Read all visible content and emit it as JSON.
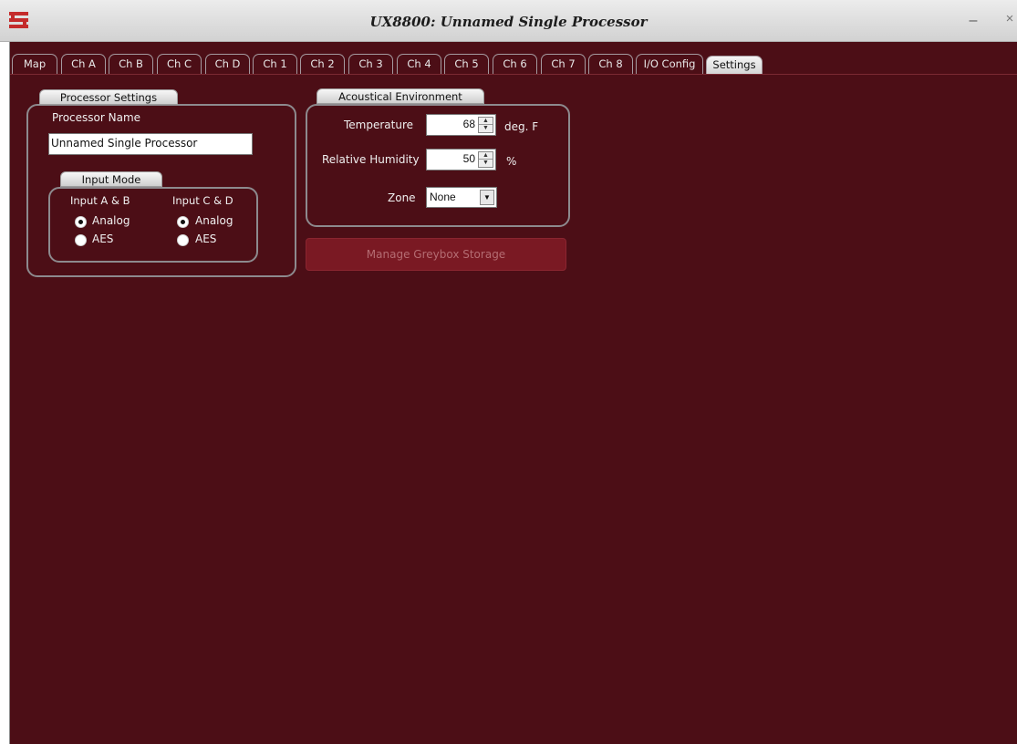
{
  "window": {
    "title": "UX8800: Unnamed Single Processor",
    "minimize_glyph": "–",
    "close_glyph": "×"
  },
  "tabs": [
    {
      "label": "Map"
    },
    {
      "label": "Ch A"
    },
    {
      "label": "Ch B"
    },
    {
      "label": "Ch C"
    },
    {
      "label": "Ch D"
    },
    {
      "label": "Ch 1"
    },
    {
      "label": "Ch 2"
    },
    {
      "label": "Ch 3"
    },
    {
      "label": "Ch 4"
    },
    {
      "label": "Ch 5"
    },
    {
      "label": "Ch 6"
    },
    {
      "label": "Ch 7"
    },
    {
      "label": "Ch 8"
    },
    {
      "label": "I/O Config"
    },
    {
      "label": "Settings"
    }
  ],
  "active_tab": "Settings",
  "processor_settings": {
    "group_label": "Processor Settings",
    "name_label": "Processor Name",
    "name_value": "Unnamed Single Processor",
    "input_mode": {
      "group_label": "Input Mode",
      "ab": {
        "label": "Input A & B",
        "options": [
          "Analog",
          "AES"
        ],
        "selected": "Analog"
      },
      "cd": {
        "label": "Input C & D",
        "options": [
          "Analog",
          "AES"
        ],
        "selected": "Analog"
      }
    }
  },
  "acoustical_environment": {
    "group_label": "Acoustical Environment",
    "temperature": {
      "label": "Temperature",
      "value": "68",
      "unit": "deg. F"
    },
    "humidity": {
      "label": "Relative Humidity",
      "value": "50",
      "unit": "%"
    },
    "zone": {
      "label": "Zone",
      "value": "None"
    }
  },
  "manage_button": {
    "label": "Manage Greybox Storage",
    "enabled": false
  },
  "colors": {
    "background": "#4c0e16",
    "titlebar": "#dcdcdc",
    "disabled_button": "#7a1923",
    "group_border": "#8d8a8e"
  }
}
